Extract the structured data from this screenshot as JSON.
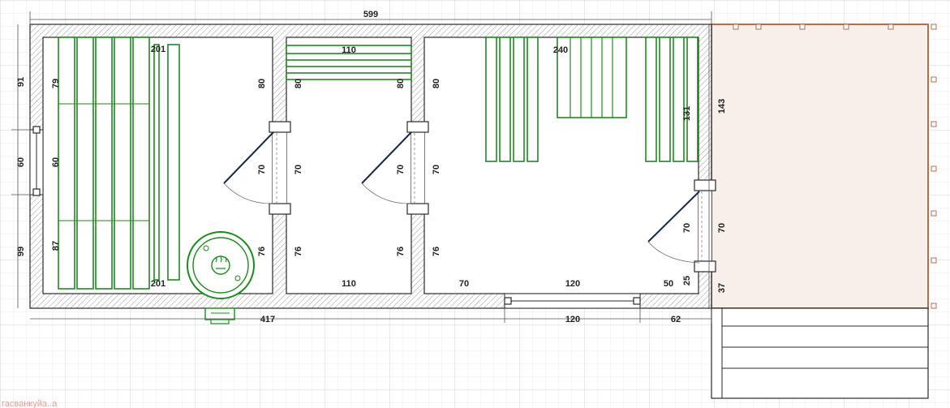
{
  "dimensions": {
    "total_width": "599",
    "bottom_left_total": "417",
    "bottom_door_width": "120",
    "bottom_right": "62",
    "left_top": "91",
    "left_window": "60",
    "left_bottom": "99",
    "steam_bench_length_top": "201",
    "steam_bench_length_bottom": "201",
    "steam_left_top": "79",
    "steam_left_window": "60",
    "steam_left_bottom": "87",
    "steam_right_top": "80",
    "steam_right_door": "70",
    "steam_right_bottom": "76",
    "wash_width_top": "110",
    "wash_width_bottom": "110",
    "wash_left_top": "80",
    "wash_left_door": "70",
    "wash_left_bottom": "76",
    "wash_right_top": "80",
    "wash_right_door": "70",
    "wash_right_bottom": "76",
    "rest_width_top": "240",
    "rest_left_top": "80",
    "rest_left_door": "70",
    "rest_left_bottom": "76",
    "rest_right_top": "131",
    "rest_right_door": "70",
    "rest_right_bottom": "25",
    "rest_bottom_left": "70",
    "rest_bottom_window": "120",
    "rest_bottom_right": "50",
    "outer_right_top": "143",
    "outer_right_door": "70",
    "outer_right_bottom": "37"
  },
  "watermark": "гасванкуйа..а",
  "colors": {
    "bench": "#1f8a1f",
    "wall_outline": "#2a2a2a",
    "terrace_fill": "#f7efe9",
    "terrace_edge": "#b07050",
    "door_leaf": "#1c2a4a"
  },
  "icons": {
    "stove": "sauna-stove-icon"
  }
}
